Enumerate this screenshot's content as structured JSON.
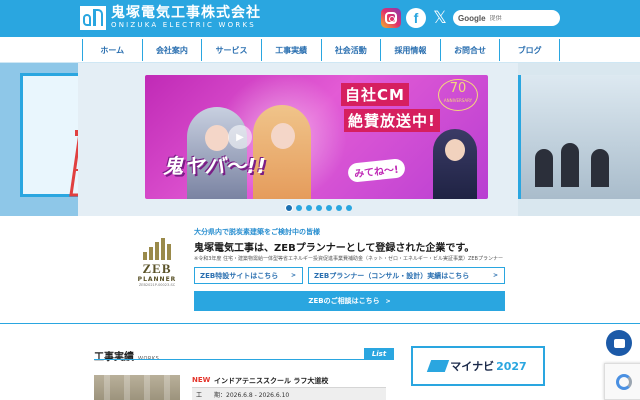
{
  "header": {
    "logo_jp": "鬼塚電気工事株式会社",
    "logo_en": "ONIZUKA ELECTRIC WORKS",
    "social": [
      "instagram-icon",
      "facebook-icon",
      "x-icon"
    ],
    "search": {
      "brand": "Google",
      "placeholder": "提供"
    }
  },
  "nav": {
    "items": [
      {
        "label": "ホーム"
      },
      {
        "label": "会社案内"
      },
      {
        "label": "サービス"
      },
      {
        "label": "工事実績"
      },
      {
        "label": "社会活動"
      },
      {
        "label": "採用情報"
      },
      {
        "label": "お問合せ"
      },
      {
        "label": "ブログ"
      }
    ]
  },
  "slider": {
    "cm_line1": "自社CM",
    "cm_line2": "絶賛放送中!",
    "oni_text": "鬼ヤバ〜!!",
    "mite_text": "みてね〜!",
    "anniversary_number": "70",
    "anniversary_label": "ANNIVERSARY",
    "dot_count": 7,
    "active_dot": 1
  },
  "zeb": {
    "logo_word": "ZEB",
    "logo_sub": "PLANNER",
    "logo_id": "ZEB2021P-00023-SC",
    "eyebrow": "大分県内で脱炭素建築をご検討中の皆様",
    "title": "鬼塚電気工事は、ZEBプランナーとして登録された企業です。",
    "note": "※令和3年度 住宅・建築物需給一体型等省エネルギー投資促進事業費補助金（ネット・ゼロ・エネルギー・ビル実証事業）ZEBプランナー",
    "btn1": "ZEB特設サイトはこちら",
    "btn2": "ZEBプランナー（コンサル・設計）実績はこちら",
    "btn_big": "ZEBのご相談はこちら",
    "arrow": ">"
  },
  "works": {
    "heading": "工事実績",
    "heading_en": "WORKS",
    "list_label": "List",
    "new_label": "NEW",
    "item_title": "インドアテニススクール ラフ大道校",
    "period_key": "工",
    "period_value": "期：2026.6.8 - 2026.6.10"
  },
  "mynavi": {
    "label": "マイナビ",
    "year": "2027"
  },
  "colors": {
    "accent": "#2aa6e0",
    "nav_text": "#2a6fb0",
    "new": "#e4352b"
  }
}
